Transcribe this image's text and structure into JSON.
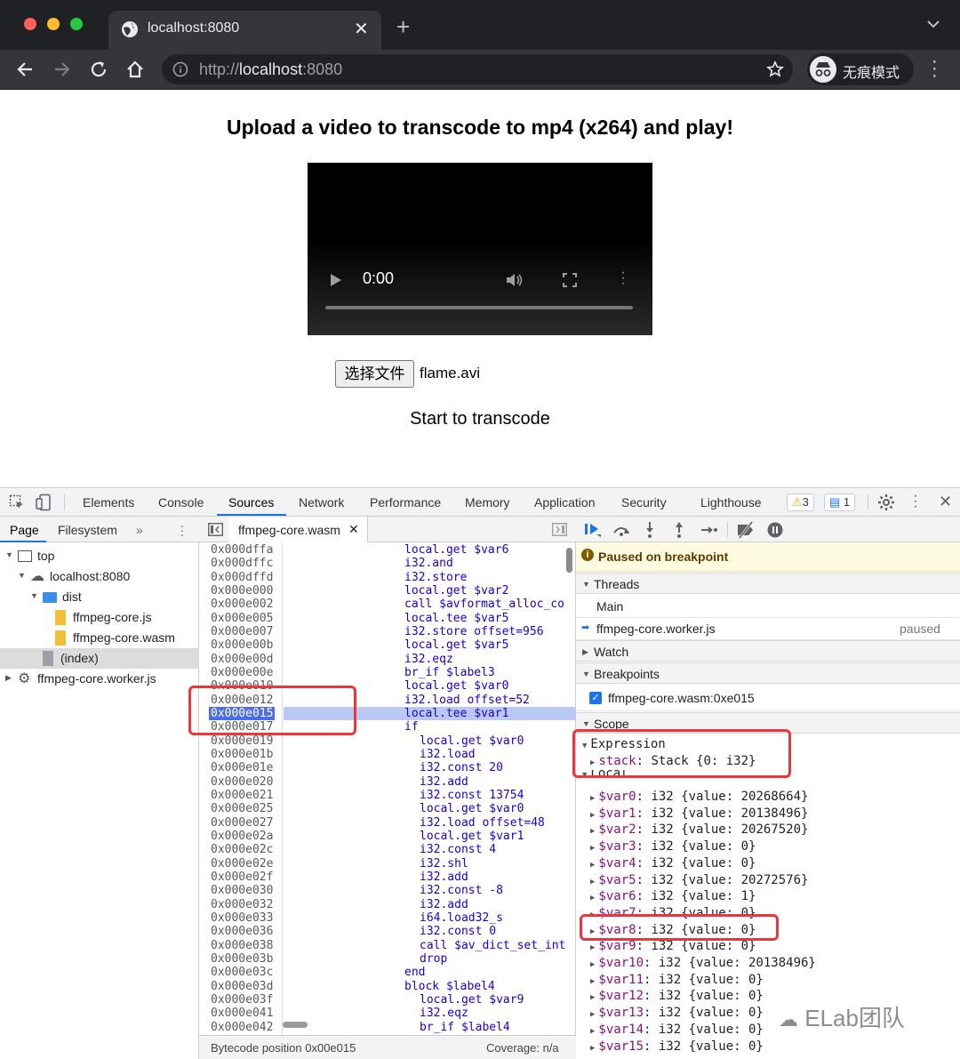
{
  "browser": {
    "tab_title": "localhost:8080",
    "url_scheme": "http://",
    "url_host": "localhost",
    "url_port": ":8080",
    "incognito_label": "无痕模式"
  },
  "page": {
    "heading": "Upload a video to transcode to mp4 (x264) and play!",
    "video_time": "0:00",
    "file_button": "选择文件",
    "file_name": "flame.avi",
    "start_text": "Start to transcode"
  },
  "devtools": {
    "tabs": [
      "Elements",
      "Console",
      "Sources",
      "Network",
      "Performance",
      "Memory",
      "Application",
      "Security",
      "Lighthouse"
    ],
    "active_tab": "Sources",
    "warn_count": "3",
    "msg_count": "1",
    "nav_tabs": [
      "Page",
      "Filesystem"
    ],
    "tree": [
      {
        "label": "top",
        "indent": 0
      },
      {
        "label": "localhost:8080",
        "indent": 1
      },
      {
        "label": "dist",
        "indent": 2
      },
      {
        "label": "ffmpeg-core.js",
        "indent": 3
      },
      {
        "label": "ffmpeg-core.wasm",
        "indent": 3
      },
      {
        "label": "(index)",
        "indent": 2
      },
      {
        "label": "ffmpeg-core.worker.js",
        "indent": 0
      }
    ],
    "editor_file": "ffmpeg-core.wasm",
    "code": [
      {
        "addr": "0x000dffa",
        "instr": "local.get $var6",
        "indent": 0
      },
      {
        "addr": "0x000dffc",
        "instr": "i32.and",
        "indent": 0
      },
      {
        "addr": "0x000dffd",
        "instr": "i32.store",
        "indent": 0
      },
      {
        "addr": "0x000e000",
        "instr": "local.get $var2",
        "indent": 0
      },
      {
        "addr": "0x000e002",
        "instr": "call $avformat_alloc_co",
        "indent": 0
      },
      {
        "addr": "0x000e005",
        "instr": "local.tee $var5",
        "indent": 0
      },
      {
        "addr": "0x000e007",
        "instr": "i32.store offset=956",
        "indent": 0
      },
      {
        "addr": "0x000e00b",
        "instr": "local.get $var5",
        "indent": 0
      },
      {
        "addr": "0x000e00d",
        "instr": "i32.eqz",
        "indent": 0
      },
      {
        "addr": "0x000e00e",
        "instr": "br_if $label3",
        "indent": 0
      },
      {
        "addr": "0x000e010",
        "instr": "local.get $var0",
        "indent": 0
      },
      {
        "addr": "0x000e012",
        "instr": "i32.load offset=52",
        "indent": 0
      },
      {
        "addr": "0x000e015",
        "instr": "local.tee $var1",
        "indent": 0
      },
      {
        "addr": "0x000e017",
        "instr": "if",
        "indent": 0
      },
      {
        "addr": "0x000e019",
        "instr": "local.get $var0",
        "indent": 1
      },
      {
        "addr": "0x000e01b",
        "instr": "i32.load",
        "indent": 1
      },
      {
        "addr": "0x000e01e",
        "instr": "i32.const 20",
        "indent": 1
      },
      {
        "addr": "0x000e020",
        "instr": "i32.add",
        "indent": 1
      },
      {
        "addr": "0x000e021",
        "instr": "i32.const 13754",
        "indent": 1
      },
      {
        "addr": "0x000e025",
        "instr": "local.get $var0",
        "indent": 1
      },
      {
        "addr": "0x000e027",
        "instr": "i32.load offset=48",
        "indent": 1
      },
      {
        "addr": "0x000e02a",
        "instr": "local.get $var1",
        "indent": 1
      },
      {
        "addr": "0x000e02c",
        "instr": "i32.const 4",
        "indent": 1
      },
      {
        "addr": "0x000e02e",
        "instr": "i32.shl",
        "indent": 1
      },
      {
        "addr": "0x000e02f",
        "instr": "i32.add",
        "indent": 1
      },
      {
        "addr": "0x000e030",
        "instr": "i32.const -8",
        "indent": 1
      },
      {
        "addr": "0x000e032",
        "instr": "i32.add",
        "indent": 1
      },
      {
        "addr": "0x000e033",
        "instr": "i64.load32_s",
        "indent": 1
      },
      {
        "addr": "0x000e036",
        "instr": "i32.const 0",
        "indent": 1
      },
      {
        "addr": "0x000e038",
        "instr": "call $av_dict_set_int",
        "indent": 1
      },
      {
        "addr": "0x000e03b",
        "instr": "drop",
        "indent": 1
      },
      {
        "addr": "0x000e03c",
        "instr": "end",
        "indent": 0
      },
      {
        "addr": "0x000e03d",
        "instr": "block $label4",
        "indent": 0
      },
      {
        "addr": "0x000e03f",
        "instr": "local.get $var9",
        "indent": 1
      },
      {
        "addr": "0x000e041",
        "instr": "i32.eqz",
        "indent": 1
      },
      {
        "addr": "0x000e042",
        "instr": "br_if $label4",
        "indent": 1
      }
    ],
    "breakpoint_index": 12,
    "footer_position": "Bytecode position 0x00e015",
    "footer_coverage": "Coverage: n/a",
    "paused_text": "Paused on breakpoint",
    "threads_label": "Threads",
    "thread_main": "Main",
    "thread_worker": "ffmpeg-core.worker.js",
    "thread_worker_status": "paused",
    "watch_label": "Watch",
    "breakpoints_label": "Breakpoints",
    "breakpoint_item": "ffmpeg-core.wasm:0xe015",
    "scope_label": "Scope",
    "expression_label": "Expression",
    "stack_key": "stack",
    "stack_value": "Stack {0: i32}",
    "local_label": "Local",
    "locals": [
      {
        "name": "$var0",
        "value": "i32 {value: 20268664}"
      },
      {
        "name": "$var1",
        "value": "i32 {value: 20138496}"
      },
      {
        "name": "$var2",
        "value": "i32 {value: 20267520}"
      },
      {
        "name": "$var3",
        "value": "i32 {value: 0}"
      },
      {
        "name": "$var4",
        "value": "i32 {value: 0}"
      },
      {
        "name": "$var5",
        "value": "i32 {value: 20272576}"
      },
      {
        "name": "$var6",
        "value": "i32 {value: 1}"
      },
      {
        "name": "$var7",
        "value": "i32 {value: 0}"
      },
      {
        "name": "$var8",
        "value": "i32 {value: 0}"
      },
      {
        "name": "$var9",
        "value": "i32 {value: 0}"
      },
      {
        "name": "$var10",
        "value": "i32 {value: 20138496}"
      },
      {
        "name": "$var11",
        "value": "i32 {value: 0}"
      },
      {
        "name": "$var12",
        "value": "i32 {value: 0}"
      },
      {
        "name": "$var13",
        "value": "i32 {value: 0}"
      },
      {
        "name": "$var14",
        "value": "i32 {value: 0}"
      },
      {
        "name": "$var15",
        "value": "i32 {value: 0}"
      }
    ]
  },
  "watermark": "ELab团队",
  "colors": {
    "accent": "#1a73e8",
    "highlight": "#e8373d",
    "breakpoint": "#4d6ee8"
  }
}
